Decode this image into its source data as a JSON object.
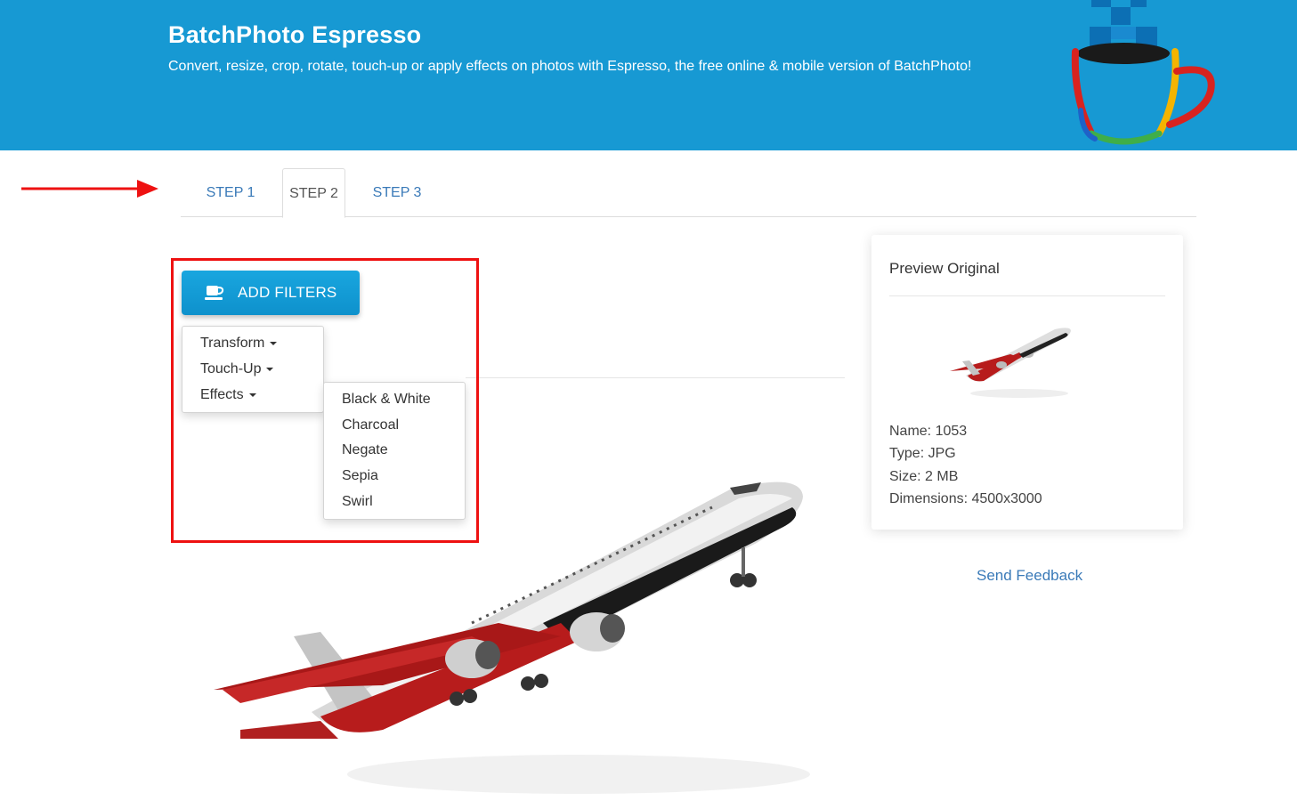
{
  "header": {
    "title": "BatchPhoto Espresso",
    "subtitle": "Convert, resize, crop, rotate, touch-up or apply effects on photos with Espresso, the free online & mobile version of BatchPhoto!"
  },
  "tabs": [
    {
      "label": "STEP 1"
    },
    {
      "label": "STEP 2"
    },
    {
      "label": "STEP 3"
    }
  ],
  "filters": {
    "button_label": "ADD FILTERS",
    "button_icon": "coffee-cup-icon",
    "menu": [
      {
        "label": "Transform"
      },
      {
        "label": "Touch-Up"
      },
      {
        "label": "Effects"
      }
    ],
    "effects_submenu": [
      {
        "label": "Black & White"
      },
      {
        "label": "Charcoal"
      },
      {
        "label": "Negate"
      },
      {
        "label": "Sepia"
      },
      {
        "label": "Swirl"
      }
    ]
  },
  "preview": {
    "title": "Preview Original",
    "name": "Name: 1053",
    "type": "Type: JPG",
    "size": "Size: 2 MB",
    "dimensions": "Dimensions: 4500x3000"
  },
  "feedback_label": "Send Feedback",
  "colors": {
    "header_bg": "#1799d3",
    "button_bg": "#0e91cc",
    "link": "#3a7ab8",
    "highlight": "#ee1111"
  }
}
